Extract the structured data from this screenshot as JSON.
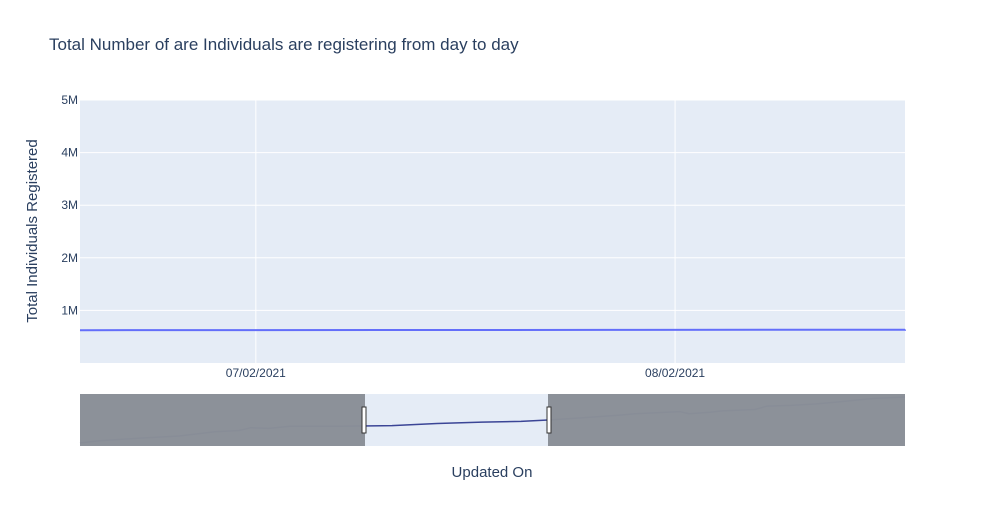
{
  "chart_data": {
    "type": "line",
    "title": "Total Number of  are Individuals  are registering from day to day",
    "xlabel": "Updated On",
    "ylabel": "Total Individuals Registered",
    "x_axis_type": "date",
    "xlim": [
      "2021-06-19",
      "2021-08-19"
    ],
    "ylim": [
      0,
      5000000
    ],
    "xticks": [
      {
        "date": "2021-07-02",
        "label": "07/02/2021"
      },
      {
        "date": "2021-08-02",
        "label": "08/02/2021"
      }
    ],
    "yticks": [
      {
        "value": 1000000,
        "label": "1M"
      },
      {
        "value": 2000000,
        "label": "2M"
      },
      {
        "value": 3000000,
        "label": "3M"
      },
      {
        "value": 4000000,
        "label": "4M"
      },
      {
        "value": 5000000,
        "label": "5M"
      }
    ],
    "grid": true,
    "legend": "none",
    "colors": {
      "plot_bg": "#e5ecf6",
      "line": "#636efa",
      "rangeslider_mask": "#8a8f97",
      "rangeslider_line": "#3b4596",
      "text": "#2a3f5f"
    },
    "series": [
      {
        "points": [
          [
            "2021-03-16",
            600000
          ],
          [
            "2021-03-22",
            603000
          ],
          [
            "2021-04-05",
            607000
          ],
          [
            "2021-04-18",
            610000
          ],
          [
            "2021-04-30",
            616000
          ],
          [
            "2021-05-08",
            618000
          ],
          [
            "2021-05-12",
            622000
          ],
          [
            "2021-05-18",
            621000
          ],
          [
            "2021-05-25",
            624000
          ],
          [
            "2021-06-10",
            624000
          ],
          [
            "2021-06-28",
            625000
          ],
          [
            "2021-07-13",
            628000
          ],
          [
            "2021-07-28",
            630000
          ],
          [
            "2021-08-10",
            631000
          ],
          [
            "2021-08-19",
            633000
          ],
          [
            "2021-08-30",
            636000
          ],
          [
            "2021-09-12",
            640000
          ],
          [
            "2021-09-17",
            642000
          ],
          [
            "2021-10-02",
            645000
          ],
          [
            "2021-10-05",
            642000
          ],
          [
            "2021-10-12",
            644000
          ],
          [
            "2021-10-16",
            646000
          ],
          [
            "2021-10-27",
            648000
          ],
          [
            "2021-10-31",
            653000
          ],
          [
            "2021-11-08",
            654000
          ],
          [
            "2021-11-16",
            656000
          ],
          [
            "2021-11-24",
            659000
          ],
          [
            "2021-12-01",
            662000
          ],
          [
            "2021-12-06",
            664000
          ],
          [
            "2021-12-16",
            666000
          ]
        ]
      }
    ]
  }
}
